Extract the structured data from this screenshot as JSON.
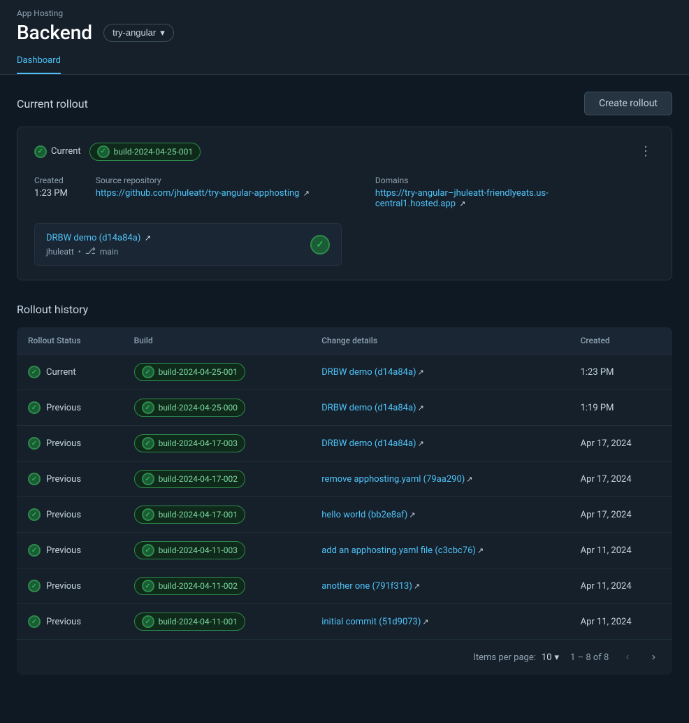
{
  "appbar": {
    "hosting_label": "App Hosting",
    "title": "Backend",
    "branch": "try-angular"
  },
  "tabs": [
    {
      "label": "Dashboard",
      "active": true
    }
  ],
  "current_rollout": {
    "section_title": "Current rollout",
    "create_btn": "Create rollout",
    "status": "Current",
    "build_id": "build-2024-04-25-001",
    "created_label": "Created",
    "created_value": "1:23 PM",
    "source_repo_label": "Source repository",
    "source_repo_url": "https://github.com/jhuleatt/try-angular-apphosting",
    "source_repo_display": "https://github.com/jhuleatt/try-angular-apphosting",
    "domains_label": "Domains",
    "domain_url": "https://try-angular–jhuleatt-friendlyeats.us-central1.hosted.app",
    "domain_display": "https://try-angular–jhuleatt-friendlyeats.us-central1.hosted.app",
    "commit_link": "DRBW demo (d14a84a)",
    "commit_user": "jhuleatt",
    "commit_branch": "main"
  },
  "rollout_history": {
    "title": "Rollout history",
    "columns": [
      "Rollout Status",
      "Build",
      "Change details",
      "Created"
    ],
    "rows": [
      {
        "status": "Current",
        "build": "build-2024-04-25-001",
        "change": "DRBW demo (d14a84a)",
        "created": "1:23 PM"
      },
      {
        "status": "Previous",
        "build": "build-2024-04-25-000",
        "change": "DRBW demo (d14a84a)",
        "created": "1:19 PM"
      },
      {
        "status": "Previous",
        "build": "build-2024-04-17-003",
        "change": "DRBW demo (d14a84a)",
        "created": "Apr 17, 2024"
      },
      {
        "status": "Previous",
        "build": "build-2024-04-17-002",
        "change": "remove apphosting.yaml (79aa290)",
        "created": "Apr 17, 2024"
      },
      {
        "status": "Previous",
        "build": "build-2024-04-17-001",
        "change": "hello world (bb2e8af)",
        "created": "Apr 17, 2024"
      },
      {
        "status": "Previous",
        "build": "build-2024-04-11-003",
        "change": "add an apphosting.yaml file (c3cbc76)",
        "created": "Apr 11, 2024"
      },
      {
        "status": "Previous",
        "build": "build-2024-04-11-002",
        "change": "another one (791f313)",
        "created": "Apr 11, 2024"
      },
      {
        "status": "Previous",
        "build": "build-2024-04-11-001",
        "change": "initial commit (51d9073)",
        "created": "Apr 11, 2024"
      }
    ],
    "items_per_page_label": "Items per page:",
    "items_per_page_value": "10",
    "range": "1 – 8 of 8"
  }
}
